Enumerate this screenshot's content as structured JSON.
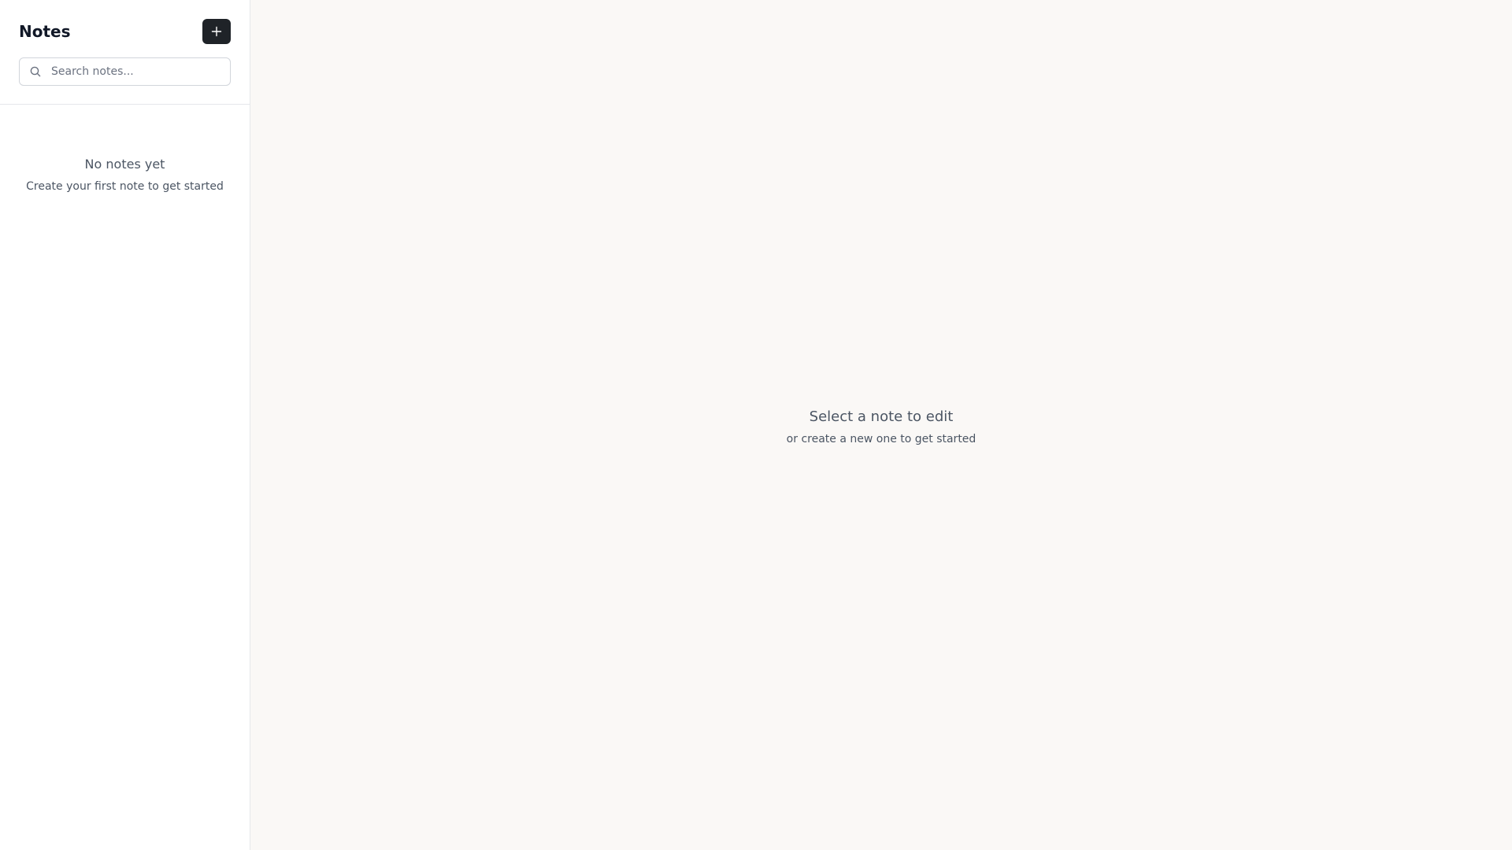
{
  "sidebar": {
    "title": "Notes",
    "new_note_icon": "plus-icon",
    "search": {
      "icon": "search-icon",
      "placeholder": "Search notes...",
      "value": ""
    },
    "empty_state": {
      "title": "No notes yet",
      "subtitle": "Create your first note to get started"
    }
  },
  "main": {
    "empty_state": {
      "title": "Select a note to edit",
      "subtitle": "or create a new one to get started"
    }
  },
  "colors": {
    "sidebar_bg": "#ffffff",
    "main_bg": "#faf8f6",
    "button_bg": "#1f2328",
    "border": "#e5e7eb"
  }
}
